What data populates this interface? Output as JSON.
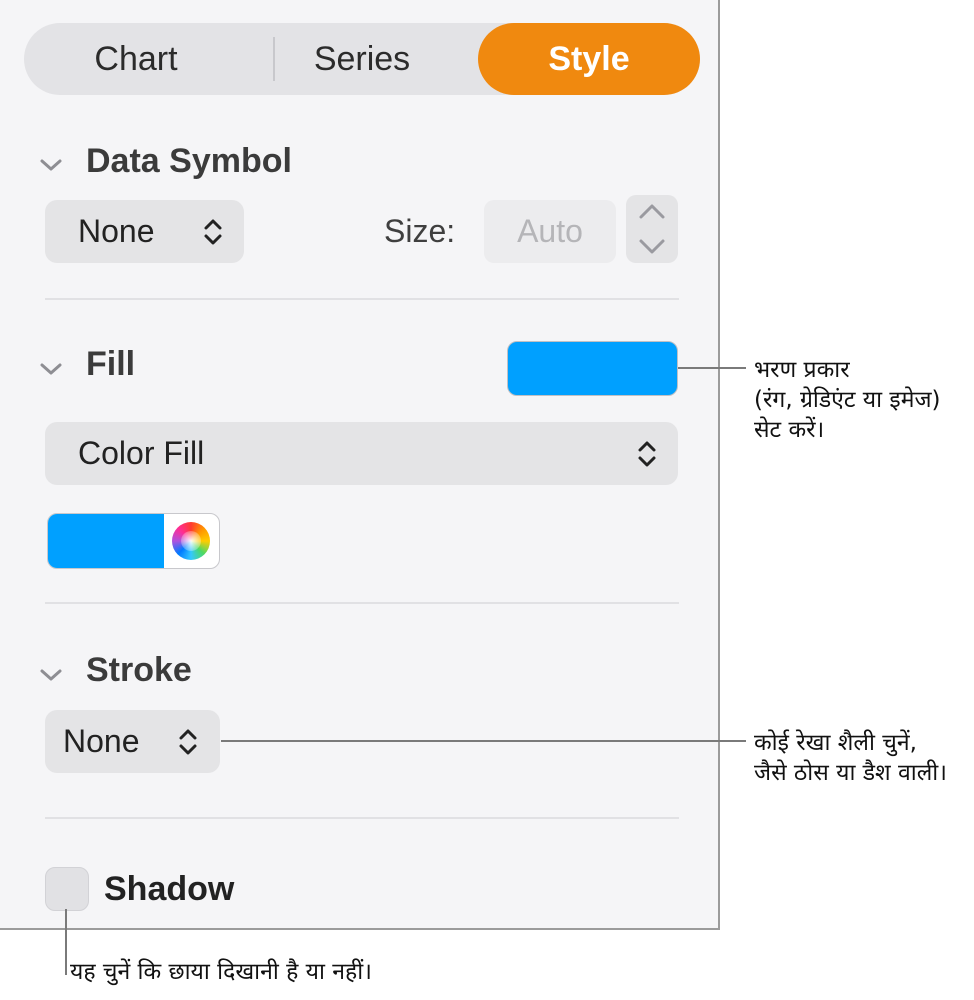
{
  "tabs": [
    {
      "label": "Chart",
      "active": false
    },
    {
      "label": "Series",
      "active": false
    },
    {
      "label": "Style",
      "active": true
    }
  ],
  "colors": {
    "accent": "#f0890f",
    "fill": "#00a0ff"
  },
  "data_symbol": {
    "title": "Data Symbol",
    "symbol_value": "None",
    "size_label": "Size:",
    "size_placeholder": "Auto"
  },
  "fill": {
    "title": "Fill",
    "type_value": "Color Fill"
  },
  "stroke": {
    "title": "Stroke",
    "style_value": "None"
  },
  "shadow": {
    "label": "Shadow",
    "checked": false
  },
  "callouts": {
    "fill_line1": "भरण प्रकार",
    "fill_line2": "(रंग, ग्रेडिएंट या इमेज)",
    "fill_line3": "सेट करें।",
    "stroke_line1": "कोई रेखा शैली चुनें,",
    "stroke_line2": "जैसे ठोस या डैश वाली।",
    "shadow_line1": "यह चुनें कि छाया दिखानी है या नहीं।"
  }
}
